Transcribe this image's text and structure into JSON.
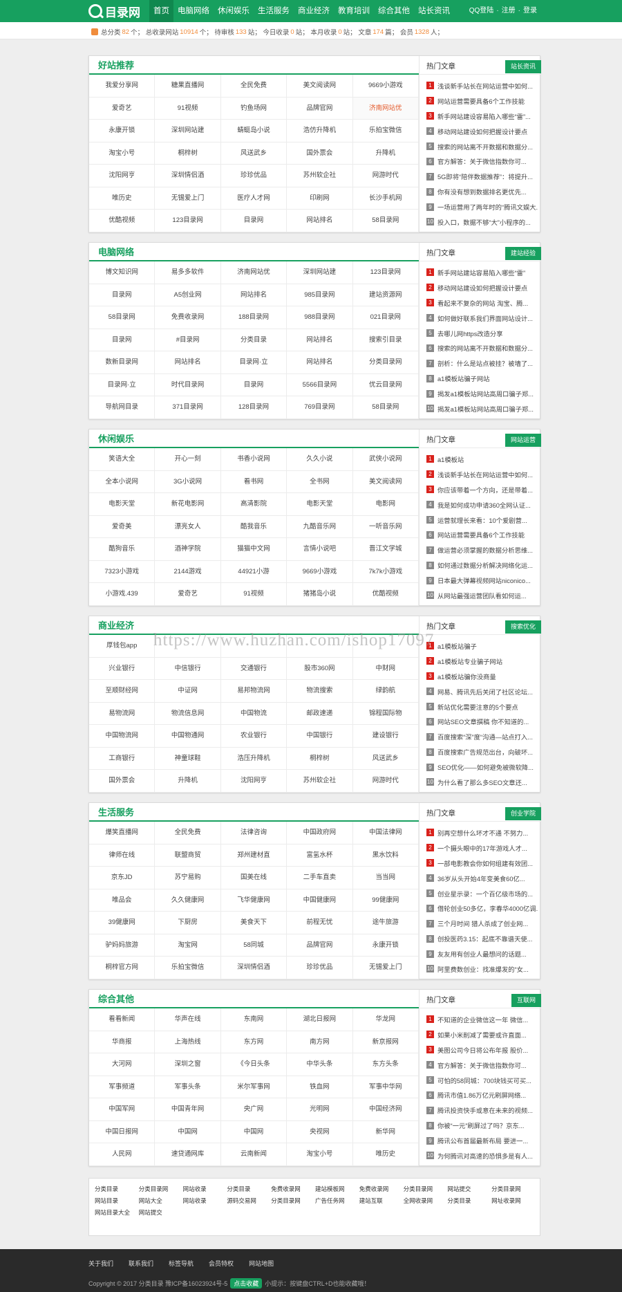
{
  "header": {
    "logo": "目录网",
    "nav": [
      "首页",
      "电脑网络",
      "休闲娱乐",
      "生活服务",
      "商业经济",
      "教育培训",
      "综合其他",
      "站长资讯"
    ],
    "user_links": [
      "QQ登陆",
      "·",
      "注册",
      "·",
      "登录"
    ]
  },
  "stats": {
    "t1": "总分类",
    "v1": "82",
    "t2": "个；",
    "t3": "总收录网站",
    "v2": "10914",
    "t4": "个；",
    "t5": "待审核",
    "v3": "133",
    "t6": "站；",
    "t7": "今日收录",
    "v4": "0",
    "t8": "站；",
    "t9": "本月收录",
    "v5": "0",
    "t10": "站；",
    "t11": "文章",
    "v6": "174",
    "t12": "篇；",
    "t13": "会员",
    "v7": "1328",
    "t14": "人；"
  },
  "sections": [
    {
      "title": "好站推荐",
      "hot_title": "热门文章",
      "badge": "站长资讯",
      "sites": [
        "我爱分享网",
        "糖果直播网",
        "全民免费",
        "美文阅读网",
        "9669小游戏",
        "爱奇艺",
        "91视频",
        "钓鱼场网",
        "品牌官网",
        "济南网站优",
        "永康开锁",
        "深圳网站建",
        "蜻蜓岛小说",
        "浩仿升降机",
        "乐拍宝微信",
        "淘宝小号",
        "桐梓树",
        "风送武乡",
        "国外票会",
        "升降机",
        "沈阳网亨",
        "深圳情侣酒",
        "珍珍优品",
        "苏州软企社",
        "网游时代",
        "唯历史",
        "无锡爱上门",
        "医疗人才网",
        "印刷网",
        "长沙手机网",
        "优酷视频",
        "123目录网",
        "目录网",
        "网站排名",
        "58目录网"
      ],
      "hot": [
        "浅谈新手站长在网站运营中如何...",
        "网站运营需要具备6个工作技能",
        "新手网站建设容易陷入哪些“雷”...",
        "移动网站建设如何把握设计要点",
        "搜索的网站离不开数据和数据分...",
        "官方解答：关于微信指数你可...",
        "5G即将“陪伴数据推荐”：将提升...",
        "你有没有想到数据排名更优先...",
        "一场运营用了两年时的“腾讯文娱大...",
        "投入口，数据不够“大”小程序的..."
      ]
    },
    {
      "title": "电脑网络",
      "hot_title": "热门文章",
      "badge": "建站经验",
      "sites": [
        "博文知识网",
        "易多多软件",
        "济南网站优",
        "深圳网站建",
        "123目录网",
        "目录网",
        "A5创业网",
        "网站排名",
        "985目录网",
        "建站资源网",
        "58目录网",
        "免费收录网",
        "188目录网",
        "988目录网",
        "021目录网",
        "目录网",
        "#目录网",
        "分类目录",
        "网站排名",
        "搜索引目录",
        "数新目录网",
        "网站排名",
        "目录网·立",
        "网站排名",
        "分类目录网",
        "目录网·立",
        "时代目录网",
        "目录网",
        "5566目录网",
        "优云目录网",
        "导航网目录",
        "371目录网",
        "128目录网",
        "769目录网",
        "58目录网"
      ],
      "hot": [
        "新手网站建站容易陷入哪些“雷”",
        "移动网站建设如何把握设计要点",
        "看起来不复杂的网站 淘宝、腾...",
        "如何做好联系我们界面网站设计...",
        "去哪儿网https改造分享",
        "搜索的网站离不开数据和数据分...",
        "剖析：什么是站点被挂？被墙了...",
        "a1模板站骗子网站",
        "揭发a1模板站网站高周口骗子郑...",
        "揭发a1模板站网站高周口骗子郑..."
      ]
    },
    {
      "title": "休闲娱乐",
      "hot_title": "热门文章",
      "badge": "网站运营",
      "sites": [
        "笑语大全",
        "开心一刻",
        "书香小说网",
        "久久小说",
        "武侠小说网",
        "全本小说网",
        "3G小说网",
        "看书网",
        "全书网",
        "美文阅读网",
        "电影天堂",
        "新花电影网",
        "高清影院",
        "电影天堂",
        "电影网",
        "爱奇美",
        "漂亮女人",
        "酷我音乐",
        "九酷音乐网",
        "一听音乐网",
        "酷狗音乐",
        "酒神学院",
        "猫猫中文网",
        "言情小说吧",
        "晋江文学城",
        "7323小游戏",
        "2144游戏",
        "44921小游",
        "9669小游戏",
        "7k7k小游戏",
        "小游戏.439",
        "爱奇艺",
        "91视频",
        "猪猪岛小说",
        "优酷视频"
      ],
      "hot": [
        "a1模板站",
        "浅谈新手站长在网站运营中如何...",
        "你应该带着一个方向，还是带着...",
        "我是如何成功申请360全网认证...",
        "运营就理长来看：10个爱剧营...",
        "网站运营需要具备6个工作技能",
        "做运营必须掌握的数据分析思维...",
        "如何通过数据分析解决网络化运...",
        "日本最大弹幕视频网站niconico...",
        "从网站最强运营团队看如何运..."
      ]
    },
    {
      "title": "商业经济",
      "hot_title": "热门文章",
      "badge": "搜索优化",
      "sites": [
        "厚钱包app",
        "",
        "",
        "",
        "",
        "兴业银行",
        "中信银行",
        "交通银行",
        "股市360网",
        "中财网",
        "至顺财经网",
        "中证网",
        "易邦物流网",
        "物流搜索",
        "绿韵航",
        "易物流网",
        "物流信息网",
        "中国物流",
        "邮政速递",
        "锦程国际物",
        "中国物流网",
        "中国物通网",
        "农业银行",
        "中国银行",
        "建设银行",
        "工商银行",
        "神童球鞋",
        "浩压升降机",
        "桐梓树",
        "风送武乡",
        "国外票会",
        "升降机",
        "沈阳网亨",
        "苏州软企社",
        "网游时代"
      ],
      "hot": [
        "a1模板站骗子",
        "a1模板站专业骗子网站",
        "a1模板站骗你没商量",
        "网易、腾讯先后关闭了社区论坛...",
        "新站优化需要注意的5个要点",
        "网站SEO文章撰稿 你不知道的...",
        "百度搜索“深”度“沟通—站点打入...",
        "百度搜索广告规范出台，向破坏...",
        "SEO优化——如何避免被微软降...",
        "为什么看了那么多SEO文章还..."
      ]
    },
    {
      "title": "生活服务",
      "hot_title": "热门文章",
      "badge": "创业学院",
      "sites": [
        "爆笑直播网",
        "全民免费",
        "法律咨询",
        "中国政府网",
        "中国法律网",
        "律师在线",
        "联盟商贸",
        "郑州建材直",
        "富氢水杯",
        "黑水饮料",
        "京东JD",
        "苏宁易购",
        "国美在线",
        "二手车直卖",
        "当当网",
        "唯品会",
        "久久健康网",
        "飞华健康网",
        "中国健康网",
        "99健康网",
        "39健康网",
        "下厨房",
        "美食天下",
        "前程无忧",
        "途牛旅游",
        "驴妈妈旅游",
        "淘宝网",
        "58同城",
        "品牌官网",
        "永康开锁",
        "桐梓官方网",
        "乐拍宝微信",
        "深圳情侣酒",
        "珍珍优品",
        "无锡爱上门"
      ],
      "hot": [
        "别再空想什么坏才不通 不努力...",
        "一个摄头眼中的17年游戏人才...",
        "一部电影教会你如何组建有效团...",
        "36岁从头开始4年变美食60亿...",
        "创业星示录：一个百亿级市场的...",
        "借轮创业50多亿，李春华4000亿调...",
        "三个月时间 猎人杀成了创业网...",
        "创投医药3.15：起底不靠谱天使...",
        "友友用有创业人最想问的话题...",
        "阿里费数创业：找准爆发的“女..."
      ]
    },
    {
      "title": "综合其他",
      "hot_title": "热门文章",
      "badge": "互联网",
      "sites": [
        "看看新闻",
        "华声在线",
        "东南网",
        "湖北日报网",
        "华龙网",
        "华商报",
        "上海热线",
        "东方网",
        "南方网",
        "新京报网",
        "大河网",
        "深圳之窗",
        "《今日头条",
        "中华头条",
        "东方头条",
        "军事频道",
        "军事头条",
        "米尔军事网",
        "铁血网",
        "军事中华网",
        "中国军网",
        "中国青年网",
        "央广网",
        "光明网",
        "中国经济网",
        "中国日报网",
        "中国网",
        "中国网",
        "央视网",
        "新华网",
        "人民网",
        "速贷通网库",
        "云南新闻",
        "淘宝小号",
        "唯历史"
      ],
      "hot": [
        "不知道的企业微信这一年 微信...",
        "如果小米削减了需要或许直面...",
        "美图公司今日将公布年报 股价...",
        "官方解答：关于微信指数你可...",
        "可怕的58同城：700块钱买可买...",
        "腾讯市值1.86万亿元刷屏网络...",
        "腾讯投资快手或意在未来的视频...",
        "你被“一元”刷屏过了吗？京东...",
        "腾讯公布首届最新布局 要进一...",
        "为何腾讯对高速的恐惧多是有人..."
      ]
    }
  ],
  "watermark": "https://www.huzhan.com/ishop17097",
  "footer_links": [
    "分类目录",
    "分类目录网",
    "网站收录",
    "分类目录",
    "免费收录网",
    "建站模板网",
    "免费收录网",
    "分类目录网",
    "网站提交",
    "分类目录网",
    "网站目录",
    "网站大全",
    "网站收录",
    "源码交易网",
    "分类目录网",
    "广告任务网",
    "建站互联",
    "全网收录网",
    "分类目录",
    "网址收录网",
    "网站目录大全",
    "网站提交"
  ],
  "footer": {
    "nav": [
      "关于我们",
      "联系我们",
      "标签导航",
      "会员特权",
      "网站地图"
    ],
    "copyright": "Copyright © 2017 分类目录 豫ICP备16023924号-5",
    "fav_button": "点击收藏",
    "tip": "小提示：按键盘CTRL+D也能收藏哦！"
  }
}
